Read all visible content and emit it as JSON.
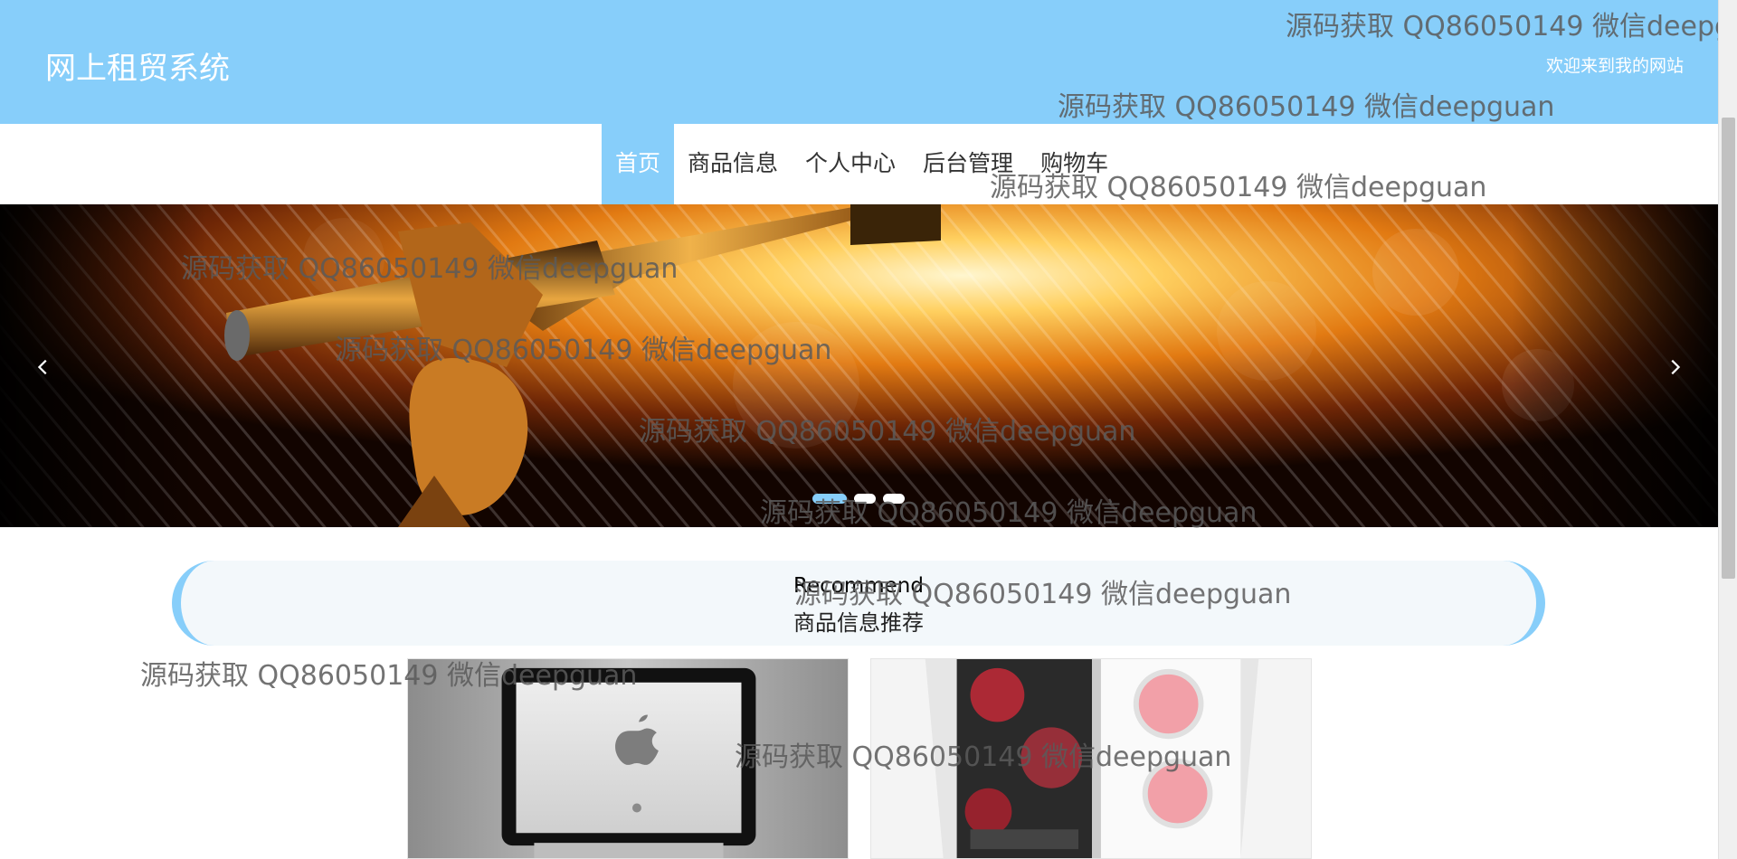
{
  "header": {
    "site_title": "网上租贸系统",
    "welcome_text": "欢迎来到我的网站"
  },
  "nav": {
    "items": [
      {
        "label": "首页",
        "active": true
      },
      {
        "label": "商品信息",
        "active": false
      },
      {
        "label": "个人中心",
        "active": false
      },
      {
        "label": "后台管理",
        "active": false
      },
      {
        "label": "购物车",
        "active": false
      }
    ]
  },
  "banner": {
    "prev_icon": "chevron-left-icon",
    "next_icon": "chevron-right-icon",
    "slide_count": 3,
    "active_slide": 1
  },
  "recommend": {
    "title_en": "Recommend",
    "title_cn": "商品信息推荐"
  },
  "products": [
    {
      "image": "laptop"
    },
    {
      "image": "pc-case"
    }
  ],
  "watermark": {
    "text": "源码获取 QQ86050149 微信deepguan"
  },
  "colors": {
    "accent": "#87cefa",
    "header_text": "#ffffff"
  }
}
